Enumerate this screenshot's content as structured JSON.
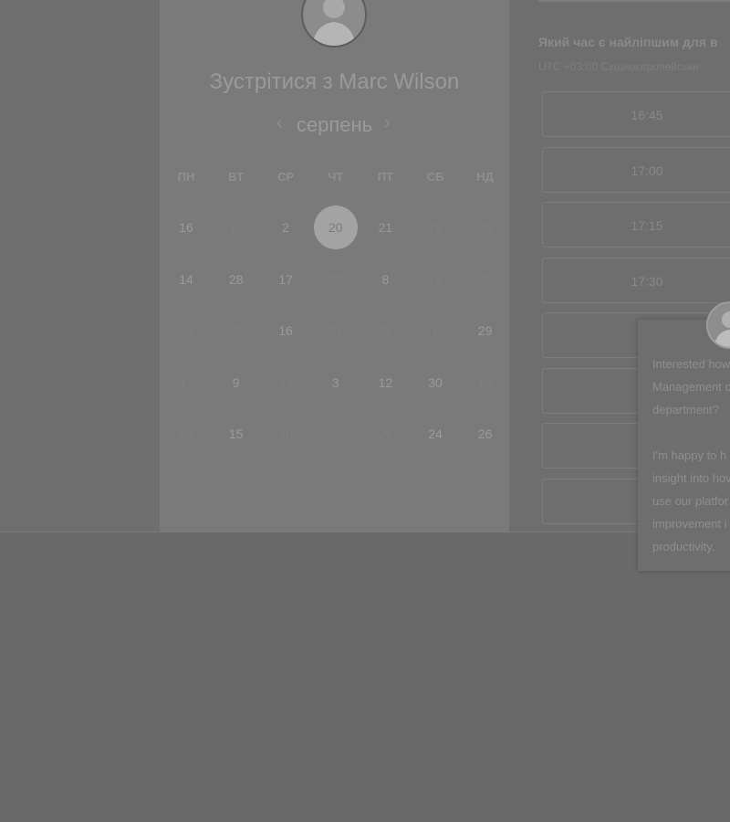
{
  "calendar": {
    "title": "Зустрітися з Marc Wilson",
    "month": "серпень",
    "prev_icon": "chevron-left-icon",
    "next_icon": "chevron-right-icon",
    "weekdays": [
      "ПН",
      "ВТ",
      "СР",
      "ЧТ",
      "ПТ",
      "СБ",
      "НД"
    ],
    "weeks": [
      [
        "16",
        "11",
        "2",
        "20",
        "21",
        "18",
        "30"
      ],
      [
        "14",
        "28",
        "17",
        "22",
        "8",
        "19",
        "22"
      ],
      [
        "24",
        "2",
        "16",
        "27",
        "28",
        "1",
        "29"
      ],
      [
        "17",
        "9",
        "24",
        "3",
        "12",
        "30",
        "18"
      ],
      [
        "29",
        "15",
        "20",
        "20",
        "26",
        "24",
        "26"
      ]
    ],
    "selected": "20"
  },
  "times": {
    "question": "Який час є найліпшим для в",
    "timezone": "UTC +03:00 Східноєвропейськи",
    "slots": [
      "16:45",
      "17:00",
      "17:15",
      "17:30",
      "",
      "",
      "",
      ""
    ]
  },
  "chat": {
    "message1": "Interested how\nManagement c\ndepartment?",
    "message2": "I'm happy to h\ninsight into hov\nuse our platfor\nimprovement i\nproductivity."
  }
}
